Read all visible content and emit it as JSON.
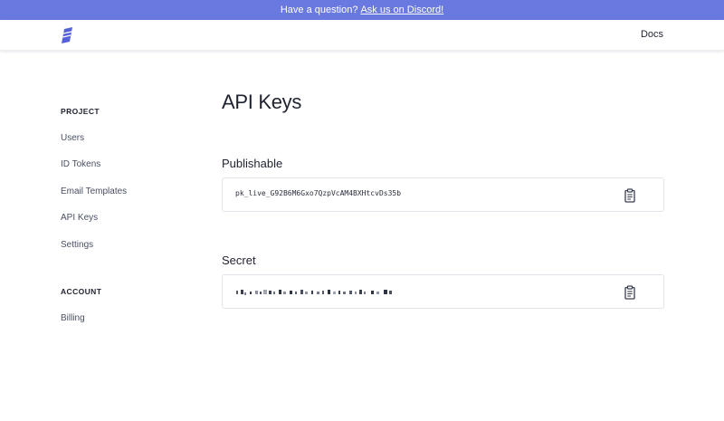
{
  "banner": {
    "text": "Have a question?",
    "link_text": "Ask us on Discord!",
    "bg_color": "#6a79e0"
  },
  "header": {
    "logo_icon": "feather-logo-icon",
    "docs_label": "Docs"
  },
  "sidebar": {
    "project_heading": "PROJECT",
    "project_items": [
      {
        "label": "Users"
      },
      {
        "label": "ID Tokens"
      },
      {
        "label": "Email Templates"
      },
      {
        "label": "API Keys"
      },
      {
        "label": "Settings"
      }
    ],
    "account_heading": "ACCOUNT",
    "account_items": [
      {
        "label": "Billing"
      }
    ]
  },
  "main": {
    "title": "API Keys",
    "publishable": {
      "label": "Publishable",
      "value": "pk_live_G92B6M6Gxo7QzpVcAM4BXHtcvDs35b",
      "copy_icon": "clipboard-icon"
    },
    "secret": {
      "label": "Secret",
      "masked": true,
      "copy_icon": "clipboard-icon"
    }
  }
}
